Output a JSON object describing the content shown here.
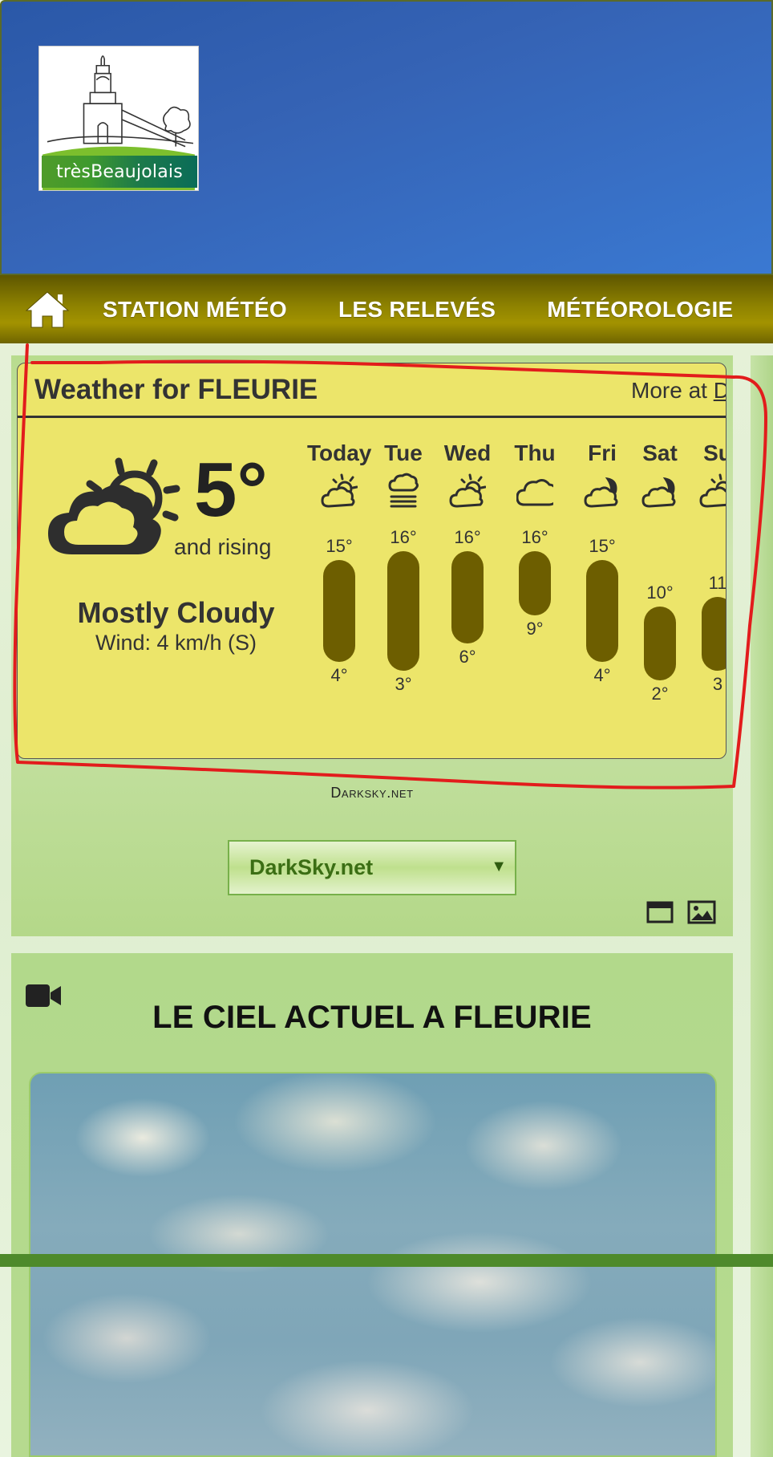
{
  "header": {
    "logo_text": "trèsBeaujolais",
    "logo_icon": "church-logo"
  },
  "nav": {
    "home_icon": "home-icon",
    "items": [
      {
        "label": "STATION MÉTÉO"
      },
      {
        "label": "LES RELEVÉS"
      },
      {
        "label": "MÉTÉOROLOGIE"
      }
    ]
  },
  "weather": {
    "title": "Weather for FLEURIE",
    "more_prefix": "More at ",
    "more_link": "D",
    "current": {
      "icon": "mostly-cloudy-icon",
      "temp": "5°",
      "trend": "and rising",
      "condition": "Mostly Cloudy",
      "wind": "Wind: 4 km/h (S)"
    },
    "forecast": [
      {
        "day": "Today",
        "icon": "partly-cloudy-icon",
        "hi": "15°",
        "lo": "4°",
        "hi_val": 15,
        "lo_val": 4
      },
      {
        "day": "Tue",
        "icon": "fog-icon",
        "hi": "16°",
        "lo": "3°",
        "hi_val": 16,
        "lo_val": 3
      },
      {
        "day": "Wed",
        "icon": "partly-cloudy-icon",
        "hi": "16°",
        "lo": "6°",
        "hi_val": 16,
        "lo_val": 6
      },
      {
        "day": "Thu",
        "icon": "cloudy-icon",
        "hi": "16°",
        "lo": "9°",
        "hi_val": 16,
        "lo_val": 9
      },
      {
        "day": "Fri",
        "icon": "partly-cloudy-night-icon",
        "hi": "15°",
        "lo": "4°",
        "hi_val": 15,
        "lo_val": 4
      },
      {
        "day": "Sat",
        "icon": "partly-cloudy-night-icon",
        "hi": "10°",
        "lo": "2°",
        "hi_val": 10,
        "lo_val": 2
      },
      {
        "day": "Su",
        "icon": "partly-cloudy-icon",
        "hi": "11",
        "lo": "3",
        "hi_val": 11,
        "lo_val": 3
      }
    ]
  },
  "source": {
    "label": "Darksky.net",
    "select_value": "DarkSky.net",
    "window_icon": "window-icon",
    "image_icon": "image-icon"
  },
  "webcam": {
    "icon": "video-camera-icon",
    "title": "LE CIEL ACTUEL A FLEURIE"
  },
  "colors": {
    "header_blue": "#3563b5",
    "nav_olive": "#8e8200",
    "card_yellow": "#ece56a",
    "bar_brown": "#6d5e00",
    "annotation_red": "#e21c1c",
    "panel_green": "#b8dc8e"
  }
}
